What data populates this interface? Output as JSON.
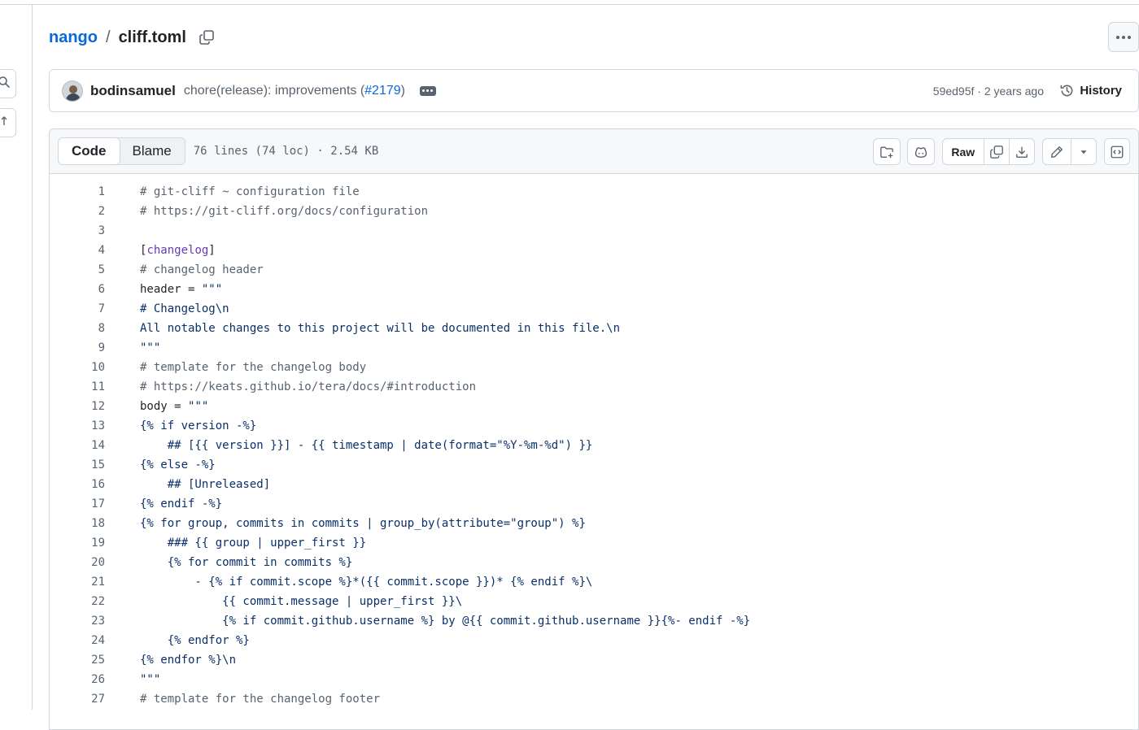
{
  "breadcrumb": {
    "repo": "nango",
    "separator": "/",
    "file": "cliff.toml",
    "copy_icon": "copy-icon"
  },
  "more_icon": "kebab-horizontal-icon",
  "commit": {
    "author": "bodinsamuel",
    "message_prefix": "chore(release): improvements (",
    "pr": "#2179",
    "message_suffix": ")",
    "sha": "59ed95f",
    "age": "2 years ago",
    "meta": "59ed95f · 2 years ago",
    "history_label": "History",
    "history_icon": "history-icon"
  },
  "file": {
    "tabs": [
      {
        "label": "Code",
        "active": true
      },
      {
        "label": "Blame",
        "active": false
      }
    ],
    "info": "76 lines (74 loc) · 2.54 KB",
    "raw_label": "Raw",
    "toolbar_icons": [
      "file-directory-add-icon",
      "copilot-icon",
      "copy-icon",
      "download-icon",
      "pencil-icon",
      "triangle-down-icon",
      "code-square-icon"
    ]
  },
  "colors": {
    "accent": "#0969da",
    "muted": "#59636e",
    "string": "#0a3069",
    "tag": "#6639ba",
    "border": "#d0d7de"
  },
  "code_lines": [
    {
      "n": "1",
      "text": "# git-cliff ~ configuration file",
      "kind": "comment"
    },
    {
      "n": "2",
      "text": "# https://git-cliff.org/docs/configuration",
      "kind": "comment"
    },
    {
      "n": "3",
      "text": "",
      "kind": "plain"
    },
    {
      "n": "4",
      "text": "[changelog]",
      "kind": "section"
    },
    {
      "n": "5",
      "text": "# changelog header",
      "kind": "comment"
    },
    {
      "n": "6",
      "text": "header = \"\"\"",
      "kind": "plain"
    },
    {
      "n": "7",
      "text": "# Changelog\\n",
      "kind": "string"
    },
    {
      "n": "8",
      "text": "All notable changes to this project will be documented in this file.\\n",
      "kind": "string"
    },
    {
      "n": "9",
      "text": "\"\"\"",
      "kind": "string"
    },
    {
      "n": "10",
      "text": "# template for the changelog body",
      "kind": "comment"
    },
    {
      "n": "11",
      "text": "# https://keats.github.io/tera/docs/#introduction",
      "kind": "comment"
    },
    {
      "n": "12",
      "text": "body = \"\"\"",
      "kind": "plain"
    },
    {
      "n": "13",
      "text": "{% if version -%}",
      "kind": "string"
    },
    {
      "n": "14",
      "text": "    ## [{{ version }}] - {{ timestamp | date(format=\"%Y-%m-%d\") }}",
      "kind": "string"
    },
    {
      "n": "15",
      "text": "{% else -%}",
      "kind": "string"
    },
    {
      "n": "16",
      "text": "    ## [Unreleased]",
      "kind": "string"
    },
    {
      "n": "17",
      "text": "{% endif -%}",
      "kind": "string"
    },
    {
      "n": "18",
      "text": "{% for group, commits in commits | group_by(attribute=\"group\") %}",
      "kind": "string"
    },
    {
      "n": "19",
      "text": "    ### {{ group | upper_first }}",
      "kind": "string"
    },
    {
      "n": "20",
      "text": "    {% for commit in commits %}",
      "kind": "string"
    },
    {
      "n": "21",
      "text": "        - {% if commit.scope %}*({{ commit.scope }})* {% endif %}\\",
      "kind": "string"
    },
    {
      "n": "22",
      "text": "            {{ commit.message | upper_first }}\\",
      "kind": "string"
    },
    {
      "n": "23",
      "text": "            {% if commit.github.username %} by @{{ commit.github.username }}{%- endif -%}",
      "kind": "string"
    },
    {
      "n": "24",
      "text": "    {% endfor %}",
      "kind": "string"
    },
    {
      "n": "25",
      "text": "{% endfor %}\\n",
      "kind": "string"
    },
    {
      "n": "26",
      "text": "\"\"\"",
      "kind": "string"
    },
    {
      "n": "27",
      "text": "# template for the changelog footer",
      "kind": "comment"
    }
  ]
}
